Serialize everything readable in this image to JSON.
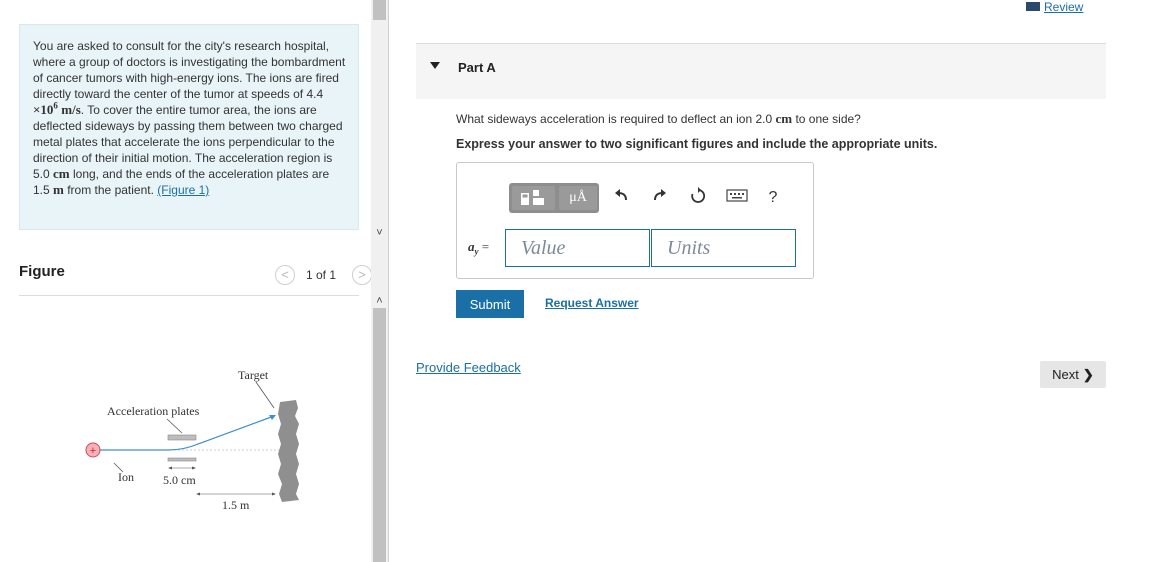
{
  "problem": {
    "intro": "You are asked to consult for the city's research hospital, where a group of doctors is investigating the bombardment of cancer tumors with high-energy ions. The ions are fired directly toward the center of the tumor at speeds of 4.4",
    "speed_times": "×10",
    "speed_exp": "6",
    "speed_unit": "m/s",
    "mid": ". To cover the entire tumor area, the ions are deflected sideways by passing them between two charged metal plates that accelerate the ions perpendicular to the direction of their initial motion. The acceleration region is 5.0",
    "len_unit": "cm",
    "tail": "long, and the ends of the acceleration plates are 1.5",
    "dist_unit": "m",
    "end": "from the patient.",
    "figure_link": "(Figure 1)"
  },
  "figure_panel": {
    "title": "Figure",
    "prev_icon": "<",
    "next_icon": ">",
    "pager": "1 of 1",
    "labels": {
      "target": "Target",
      "plates": "Acceleration plates",
      "ion": "Ion",
      "plate_length": "5.0 cm",
      "distance": "1.5 m",
      "charge": "+"
    }
  },
  "scrollbar": {
    "up": "˄",
    "down": "˅"
  },
  "review": {
    "label": "Review",
    "icon": "book-icon"
  },
  "part": {
    "title": "Part A",
    "caret_icon": "caret-down-icon"
  },
  "question": {
    "text_before": "What sideways acceleration is required to deflect an ion 2.0",
    "unit": "cm",
    "text_after": "to one side?",
    "instruction": "Express your answer to two significant figures and include the appropriate units."
  },
  "toolbar": {
    "units_button": "μÅ",
    "help": "?",
    "icons": [
      "templates-icon",
      "units-icon",
      "undo-icon",
      "redo-icon",
      "reset-icon",
      "keyboard-icon",
      "help-icon"
    ]
  },
  "answer": {
    "variable": "a",
    "subscript": "y",
    "equals": "=",
    "value_placeholder": "Value",
    "units_placeholder": "Units"
  },
  "actions": {
    "submit": "Submit",
    "request_answer": "Request Answer",
    "feedback": "Provide Feedback",
    "next": "Next",
    "next_icon": "❯"
  },
  "colors": {
    "accent": "#1a6fa6",
    "problem_bg": "#e8f4f7",
    "toolbar_bg": "#9a9a9a"
  }
}
